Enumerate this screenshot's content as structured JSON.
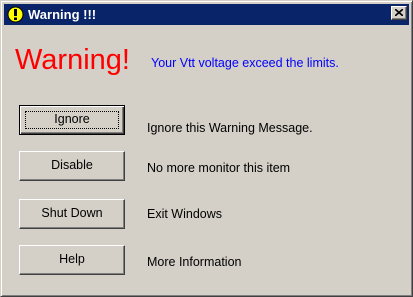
{
  "window": {
    "title": "Warning !!!",
    "title_icon": "exclamation-icon",
    "close_icon": "close-icon",
    "colors": {
      "titlebar": "#0a246a",
      "heading": "#ff0000",
      "message": "#0000ff",
      "face": "#d4d0c8"
    }
  },
  "warning": {
    "heading": "Warning!",
    "message": "Your Vtt voltage exceed the limits."
  },
  "actions": [
    {
      "label": "Ignore",
      "description": "Ignore this Warning Message."
    },
    {
      "label": "Disable",
      "description": "No more monitor this item"
    },
    {
      "label": "Shut Down",
      "description": "Exit Windows"
    },
    {
      "label": "Help",
      "description": "More Information"
    }
  ]
}
